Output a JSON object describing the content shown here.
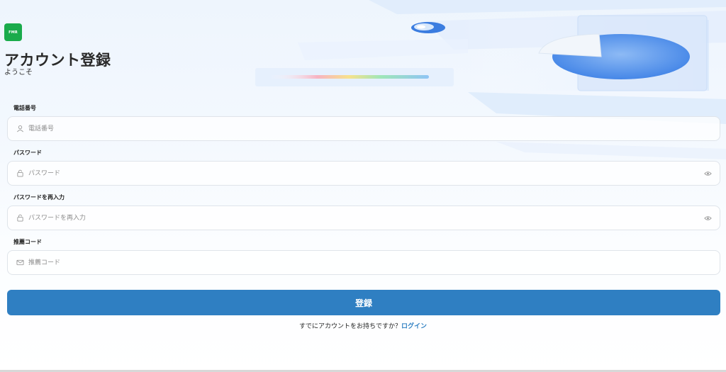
{
  "brand": {
    "logo_text": "FMR"
  },
  "header": {
    "title": "アカウント登録",
    "subtitle": "ようこそ"
  },
  "form": {
    "phone": {
      "label": "電話番号",
      "placeholder": "電話番号",
      "icon": "user-icon"
    },
    "password": {
      "label": "パスワード",
      "placeholder": "パスワード",
      "icon": "lock-icon"
    },
    "password_confirm": {
      "label": "パスワードを再入力",
      "placeholder": "パスワードを再入力",
      "icon": "lock-icon"
    },
    "referral": {
      "label": "推薦コード",
      "placeholder": "推薦コード",
      "icon": "mail-icon"
    },
    "submit_label": "登録"
  },
  "footer": {
    "prompt": "すでにアカウントをお持ちですか？",
    "login_link": "ログイン"
  },
  "colors": {
    "primary": "#2f7fc2",
    "logo": "#1aab4b"
  }
}
